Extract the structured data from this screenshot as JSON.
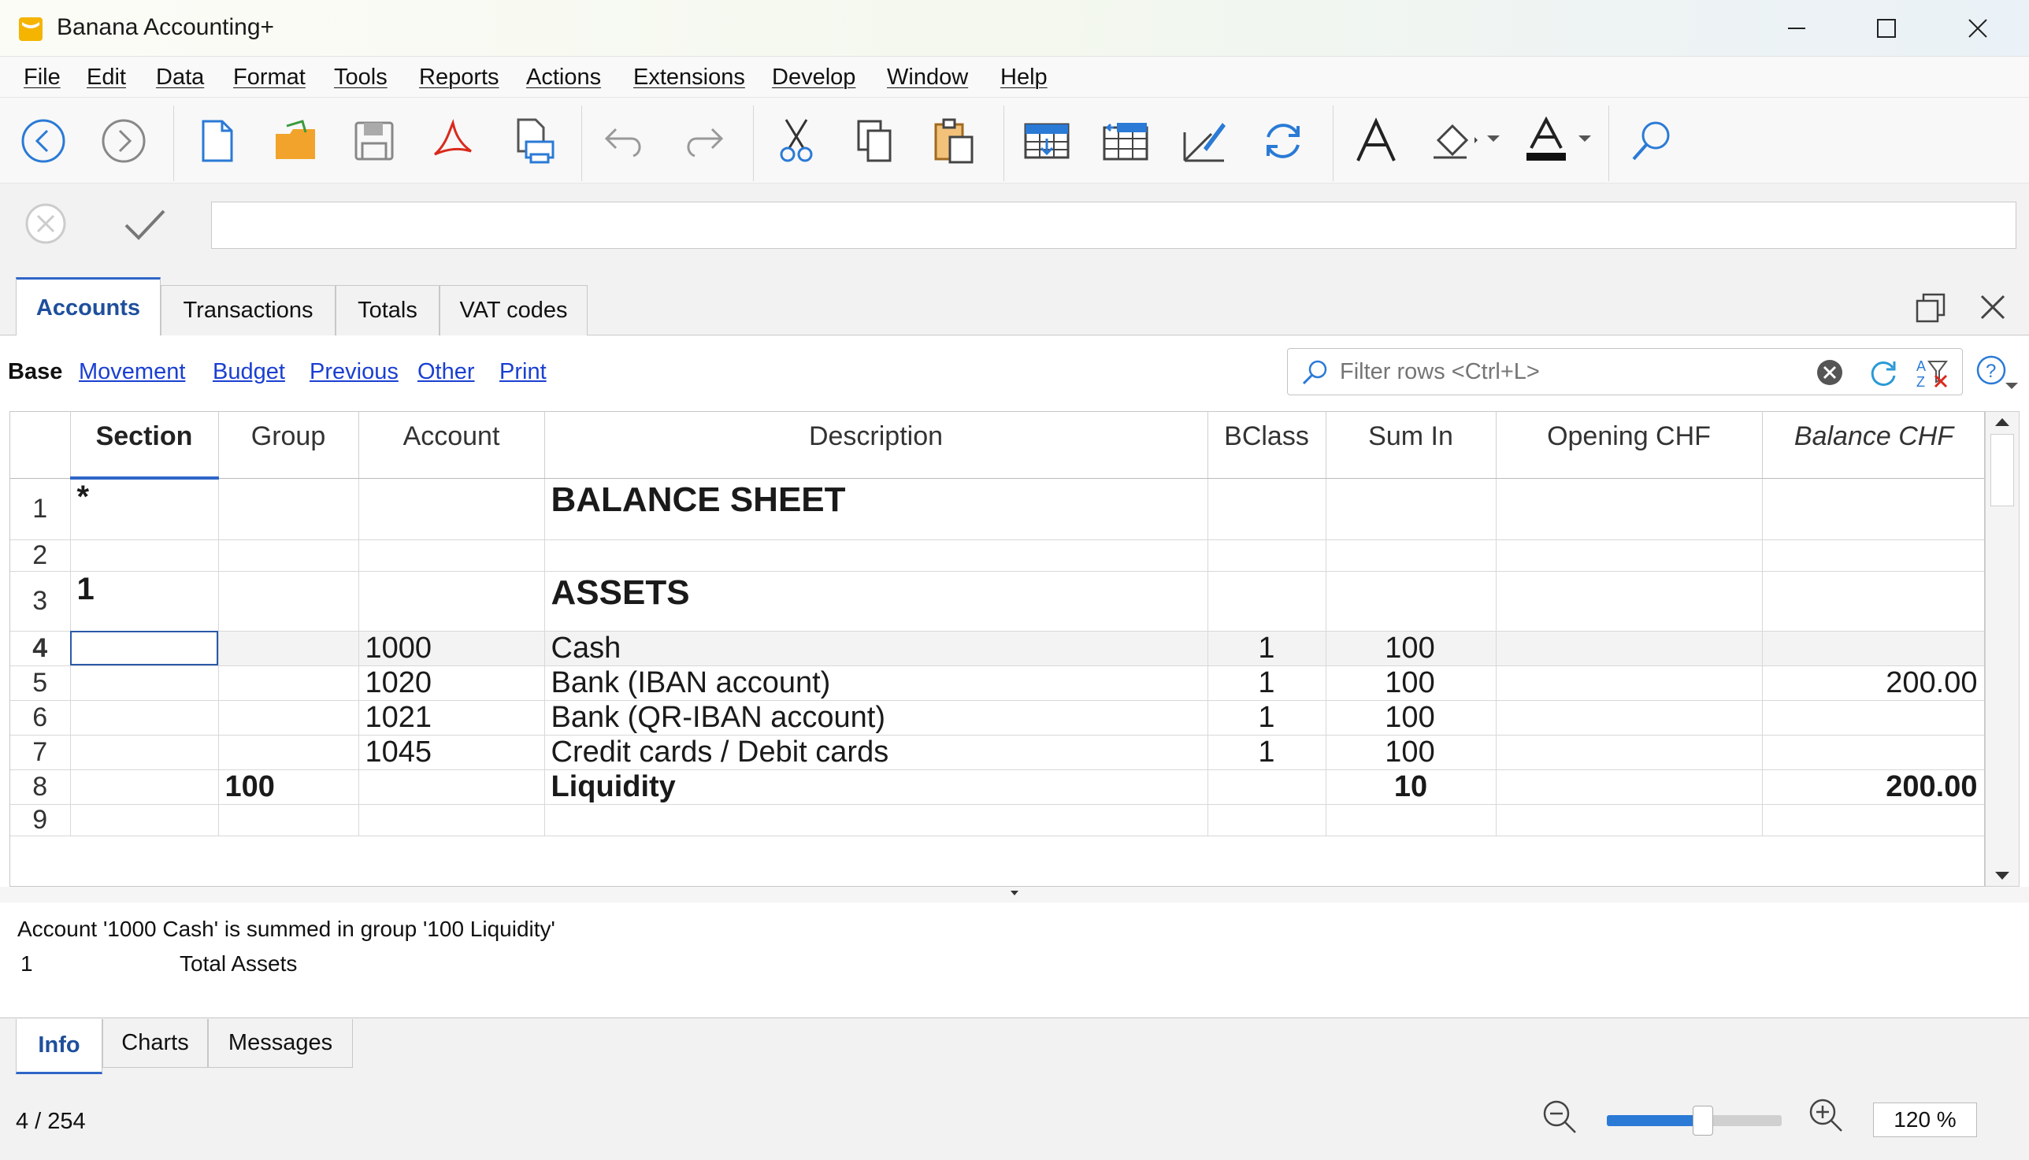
{
  "window": {
    "title": "Banana Accounting+"
  },
  "menu": [
    "File",
    "Edit",
    "Data",
    "Format",
    "Tools",
    "Reports",
    "Actions",
    "Extensions",
    "Develop",
    "Window",
    "Help"
  ],
  "toolbar": {
    "icons": [
      "back-icon",
      "forward-icon",
      "new-file-icon",
      "open-folder-icon",
      "save-icon",
      "pdf-icon",
      "print-preview-icon",
      "undo-icon",
      "redo-icon",
      "cut-icon",
      "copy-icon",
      "paste-icon",
      "add-rows-icon",
      "insert-rows-icon",
      "edit-icon",
      "recalculate-icon",
      "font-icon",
      "fill-color-icon",
      "text-color-icon",
      "search-icon"
    ]
  },
  "editbar": {
    "value": ""
  },
  "tabs": [
    "Accounts",
    "Transactions",
    "Totals",
    "VAT codes"
  ],
  "active_tab": "Accounts",
  "views": {
    "current": "Base",
    "links": [
      "Movement",
      "Budget",
      "Previous",
      "Other",
      "Print"
    ]
  },
  "filter": {
    "placeholder": "Filter rows <Ctrl+L>"
  },
  "table": {
    "columns": [
      "Section",
      "Group",
      "Account",
      "Description",
      "BClass",
      "Sum In",
      "Opening CHF",
      "Balance CHF"
    ],
    "rows": [
      {
        "n": "1",
        "section": "*",
        "group": "",
        "account": "",
        "description": "BALANCE SHEET",
        "bclass": "",
        "sumin": "",
        "opening": "",
        "balance": ""
      },
      {
        "n": "2",
        "section": "",
        "group": "",
        "account": "",
        "description": "",
        "bclass": "",
        "sumin": "",
        "opening": "",
        "balance": ""
      },
      {
        "n": "3",
        "section": "1",
        "group": "",
        "account": "",
        "description": "ASSETS",
        "bclass": "",
        "sumin": "",
        "opening": "",
        "balance": ""
      },
      {
        "n": "4",
        "section": "",
        "group": "",
        "account": "1000",
        "description": "Cash",
        "bclass": "1",
        "sumin": "100",
        "opening": "",
        "balance": ""
      },
      {
        "n": "5",
        "section": "",
        "group": "",
        "account": "1020",
        "description": "Bank (IBAN account)",
        "bclass": "1",
        "sumin": "100",
        "opening": "",
        "balance": "200.00"
      },
      {
        "n": "6",
        "section": "",
        "group": "",
        "account": "1021",
        "description": "Bank (QR-IBAN account)",
        "bclass": "1",
        "sumin": "100",
        "opening": "",
        "balance": ""
      },
      {
        "n": "7",
        "section": "",
        "group": "",
        "account": "1045",
        "description": "Credit cards / Debit cards",
        "bclass": "1",
        "sumin": "100",
        "opening": "",
        "balance": ""
      },
      {
        "n": "8",
        "section": "",
        "group": "100",
        "account": "",
        "description": "Liquidity",
        "bclass": "",
        "sumin": "10",
        "opening": "",
        "balance": "200.00"
      },
      {
        "n": "9",
        "section": "",
        "group": "",
        "account": "",
        "description": "",
        "bclass": "",
        "sumin": "",
        "opening": "",
        "balance": ""
      }
    ]
  },
  "info": {
    "line1": "Account '1000 Cash' is summed in group '100 Liquidity'",
    "line2_code": "1",
    "line2_text": "Total Assets"
  },
  "bottom_tabs": [
    "Info",
    "Charts",
    "Messages"
  ],
  "status": {
    "position": "4 / 254",
    "zoom": "120 %",
    "zoom_level": 0.55
  },
  "colors": {
    "accent": "#2f66c8",
    "link": "#1a3fd1",
    "logo": "#f4b400",
    "pdf": "#d92a1c"
  }
}
